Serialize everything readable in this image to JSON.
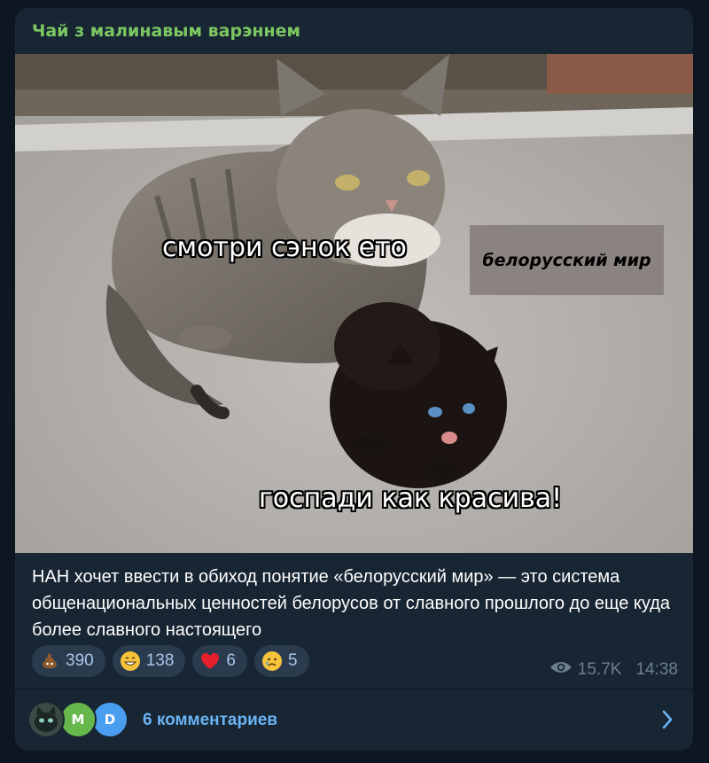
{
  "channel": {
    "name": "Чай з малинавым варэннем"
  },
  "image": {
    "top_text": "смотри сэнок ето",
    "label_text": "белорусский мир",
    "bottom_text": "госпади как красива!"
  },
  "post": {
    "caption": "НАН хочет ввести в обиход понятие «белорусский мир» — это система общенациональных ценностей белорусов от славного прошлого до еще куда более славного настоящего",
    "views": "15.7K",
    "time": "14:38"
  },
  "reactions": [
    {
      "icon": "poop-emoji-icon",
      "count": "390"
    },
    {
      "icon": "grinning-emoji-icon",
      "count": "138"
    },
    {
      "icon": "red-heart-emoji-icon",
      "count": "6"
    },
    {
      "icon": "crying-emoji-icon",
      "count": "5"
    }
  ],
  "comments": {
    "label": "6 комментариев",
    "avatars": [
      {
        "kind": "photo",
        "initial": ""
      },
      {
        "kind": "letter",
        "initial": "M",
        "color": "#66b84c"
      },
      {
        "kind": "letter",
        "initial": "D",
        "color": "#4a9ef0"
      }
    ]
  },
  "colors": {
    "background": "#0e1621",
    "bubble": "#182533",
    "channel_name": "#7bc862",
    "link": "#6ab3f3",
    "meta": "#6d7f8f"
  }
}
